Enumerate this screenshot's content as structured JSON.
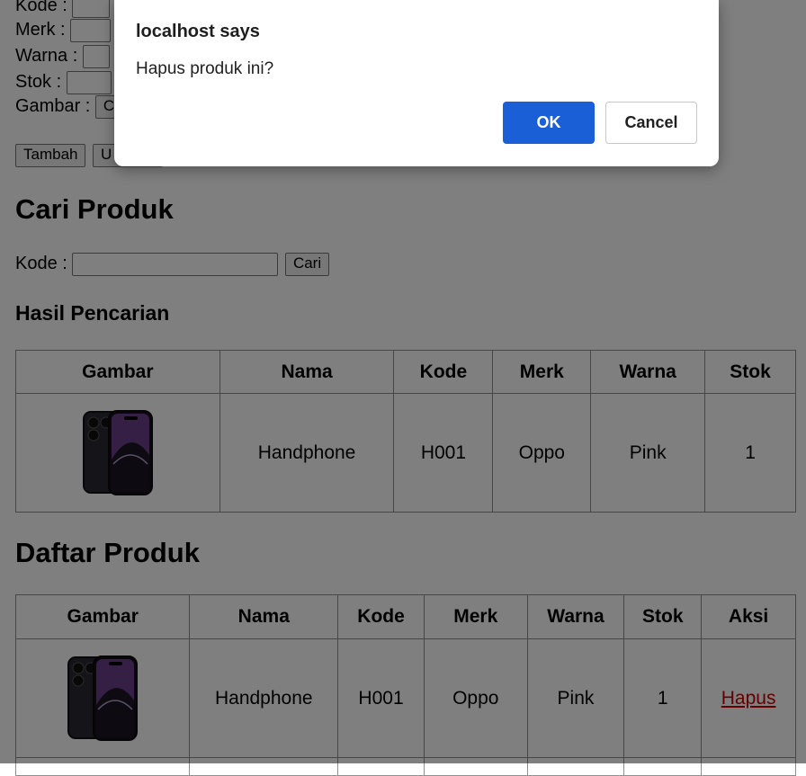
{
  "form": {
    "kode_label": "Kode :",
    "merk_label": "Merk :",
    "warna_label": "Warna :",
    "stok_label": "Stok :",
    "gambar_label": "Gambar :",
    "file_button_partial": "C",
    "tambah_button": "Tambah",
    "update_button_partial": "U"
  },
  "search": {
    "title": "Cari Produk",
    "kode_label": "Kode :",
    "cari_button": "Cari"
  },
  "results": {
    "title": "Hasil Pencarian",
    "columns": [
      "Gambar",
      "Nama",
      "Kode",
      "Merk",
      "Warna",
      "Stok"
    ],
    "rows": [
      {
        "image_icon": "phone-image",
        "nama": "Handphone",
        "kode": "H001",
        "merk": "Oppo",
        "warna": "Pink",
        "stok": "1"
      }
    ]
  },
  "list": {
    "title": "Daftar Produk",
    "columns": [
      "Gambar",
      "Nama",
      "Kode",
      "Merk",
      "Warna",
      "Stok",
      "Aksi"
    ],
    "rows": [
      {
        "image_icon": "phone-image",
        "nama": "Handphone",
        "kode": "H001",
        "merk": "Oppo",
        "warna": "Pink",
        "stok": "1",
        "aksi": "Hapus"
      }
    ]
  },
  "dialog": {
    "title": "localhost says",
    "message": "Hapus produk ini?",
    "ok_label": "OK",
    "cancel_label": "Cancel"
  },
  "colors": {
    "accent": "#1a5fd6",
    "link": "#cc0000"
  }
}
